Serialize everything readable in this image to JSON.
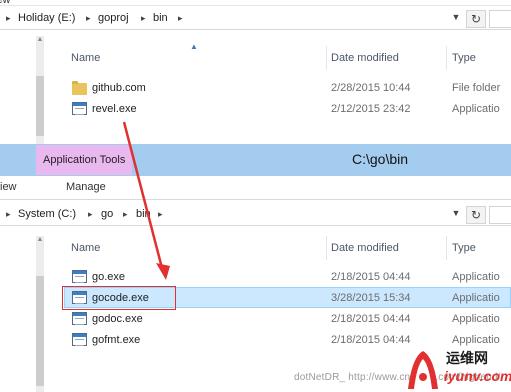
{
  "top_window": {
    "partial_title": "iew",
    "address": {
      "crumbs": [
        "Holiday (E:)",
        "goproj",
        "bin"
      ]
    },
    "columns": {
      "name": "Name",
      "date": "Date modified",
      "type": "Type"
    },
    "files": [
      {
        "name": "github.com",
        "date": "2/28/2015 10:44",
        "type": "File folder",
        "icon": "folder-icon"
      },
      {
        "name": "revel.exe",
        "date": "2/12/2015 23:42",
        "type": "Applicatio",
        "icon": "exe-icon"
      }
    ]
  },
  "ribbon": {
    "contextual_tab": "Application Tools",
    "path_title": "C:\\go\\bin",
    "tabs": [
      "iew",
      "Manage"
    ]
  },
  "bottom_window": {
    "address": {
      "crumbs": [
        "System (C:)",
        "go",
        "bin"
      ]
    },
    "columns": {
      "name": "Name",
      "date": "Date modified",
      "type": "Type"
    },
    "files": [
      {
        "name": "go.exe",
        "date": "2/18/2015 04:44",
        "type": "Applicatio",
        "icon": "exe-icon"
      },
      {
        "name": "gocode.exe",
        "date": "3/28/2015 15:34",
        "type": "Applicatio",
        "icon": "exe-icon",
        "selected": true
      },
      {
        "name": "godoc.exe",
        "date": "2/18/2015 04:44",
        "type": "Applicatio",
        "icon": "exe-icon"
      },
      {
        "name": "gofmt.exe",
        "date": "2/18/2015 04:44",
        "type": "Applicatio",
        "icon": "exe-icon"
      }
    ]
  },
  "annotation": {
    "color": "#e03030"
  },
  "watermark": {
    "text": "dotNetDR_ http://www.cnblogs.com/highend/"
  },
  "logo": {
    "line1": "运维网",
    "line2": "iyunv.com"
  },
  "colors": {
    "ribbon": "#a4ccef",
    "contextual": "#e9b8ee",
    "selection": "#cce8ff"
  }
}
